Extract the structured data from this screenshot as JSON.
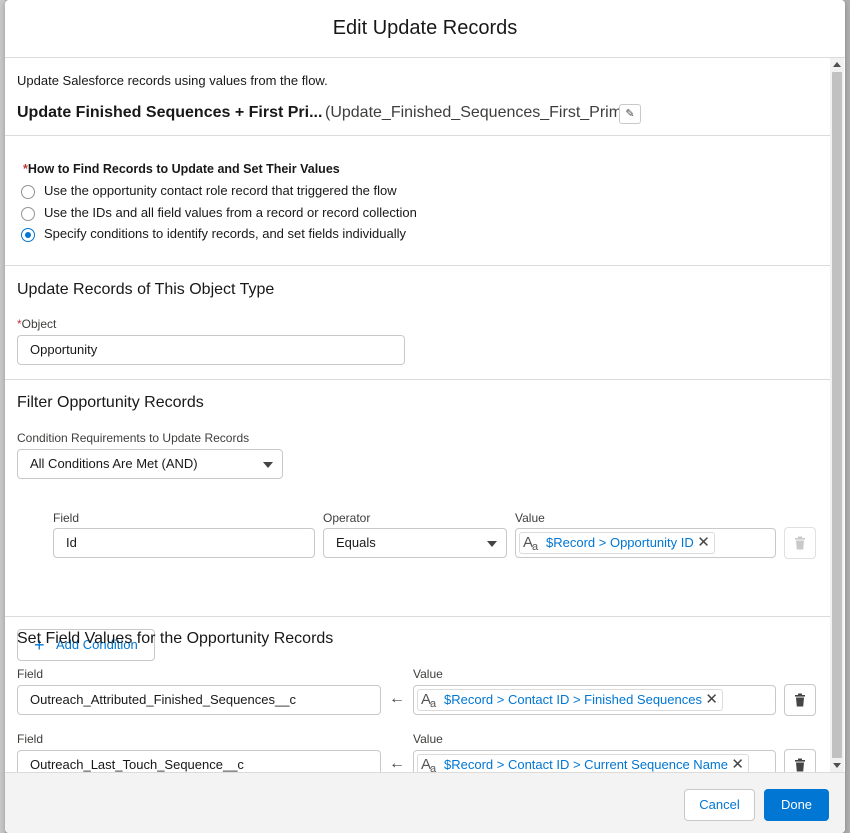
{
  "modal": {
    "title": "Edit Update Records"
  },
  "element": {
    "description": "Update Salesforce records using values from the flow.",
    "label": "Update Finished Sequences + First Pri...",
    "api_name": "(Update_Finished_Sequences_First_Prim..."
  },
  "how_to_find": {
    "required_mark": "*",
    "label": "How to Find Records to Update and Set Their Values",
    "options": [
      {
        "label": "Use the opportunity contact role record that triggered the flow",
        "selected": false
      },
      {
        "label": "Use the IDs and all field values from a record or record collection",
        "selected": false
      },
      {
        "label": "Specify conditions to identify records, and set fields individually",
        "selected": true
      }
    ]
  },
  "object_section": {
    "title": "Update Records of This Object Type",
    "object_label": "Object",
    "object_value": "Opportunity"
  },
  "filter_section": {
    "title": "Filter Opportunity Records",
    "requirement_label": "Condition Requirements to Update Records",
    "requirement_value": "All Conditions Are Met (AND)",
    "condition": {
      "field_label": "Field",
      "field_value": "Id",
      "operator_label": "Operator",
      "operator_value": "Equals",
      "value_label": "Value",
      "value_pill": "$Record > Opportunity ID"
    },
    "add_condition_label": "Add Condition"
  },
  "set_section": {
    "title": "Set Field Values for the Opportunity Records",
    "rows": [
      {
        "field_label": "Field",
        "field_value": "Outreach_Attributed_Finished_Sequences__c",
        "value_label": "Value",
        "value_pill": "$Record > Contact ID > Finished Sequences"
      },
      {
        "field_label": "Field",
        "field_value": "Outreach_Last_Touch_Sequence__c",
        "value_label": "Value",
        "value_pill": "$Record > Contact ID > Current Sequence Name"
      }
    ]
  },
  "footer": {
    "cancel_label": "Cancel",
    "done_label": "Done"
  },
  "colors": {
    "brand": "#0176d3",
    "required": "#c23934",
    "border": "#dddbda"
  },
  "icons": {
    "edit": "pencil-icon",
    "text_type": "text-type-icon",
    "remove": "close-icon",
    "delete": "trash-icon",
    "assign": "left-arrow-icon",
    "add": "plus-icon",
    "dropdown": "chevron-down-icon"
  }
}
